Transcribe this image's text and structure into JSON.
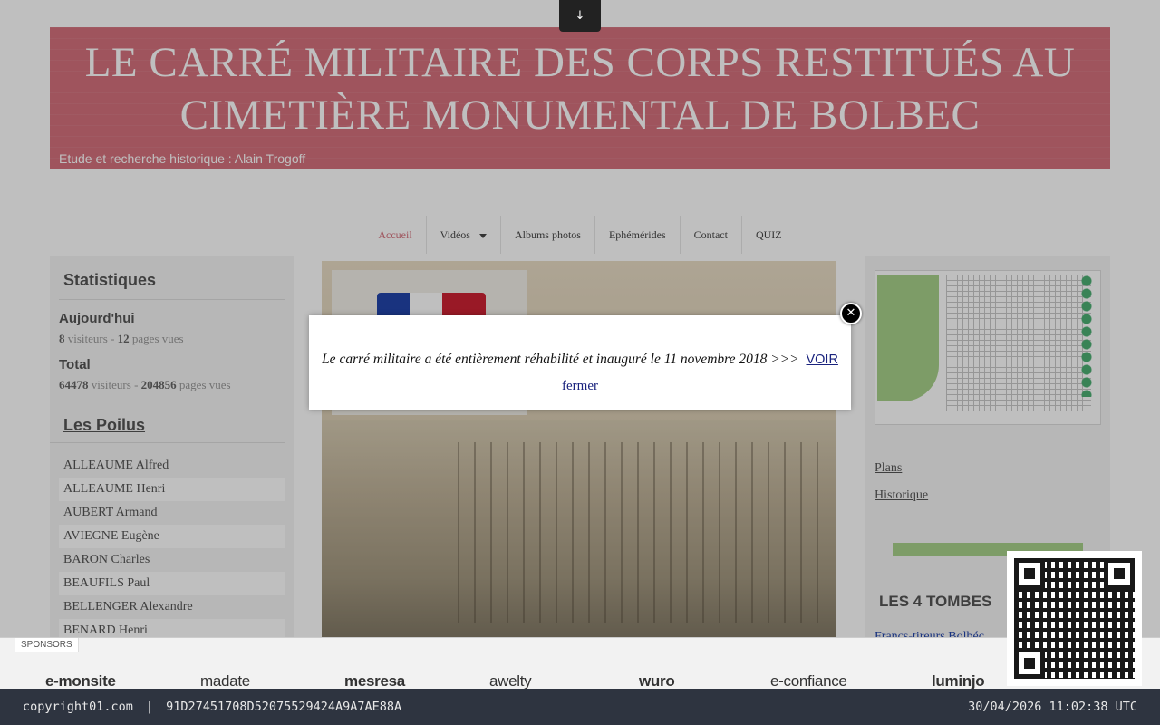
{
  "download_tab": {
    "icon": "download-arrow-icon",
    "glyph": "↓"
  },
  "header": {
    "title": "LE CARRÉ MILITAIRE DES CORPS RESTITUÉS AU CIMETIÈRE MONUMENTAL DE BOLBEC",
    "subtitle": "Etude et recherche historique : Alain Trogoff"
  },
  "menu": {
    "items": [
      {
        "label": "Accueil",
        "active": true
      },
      {
        "label": "Vidéos",
        "has_dropdown": true
      },
      {
        "label": "Albums photos"
      },
      {
        "label": "Ephémérides"
      },
      {
        "label": "Contact"
      },
      {
        "label": "QUIZ"
      }
    ]
  },
  "stats": {
    "title": "Statistiques",
    "today_label": "Aujourd'hui",
    "today_visitors": "8",
    "today_visitors_suffix": "visiteurs",
    "today_pages": "12",
    "today_pages_suffix": "pages vues",
    "total_label": "Total",
    "total_visitors": "64478",
    "total_visitors_suffix": "visiteurs",
    "total_pages": "204856",
    "total_pages_suffix": "pages vues",
    "separator": "-"
  },
  "poilus": {
    "title": "Les Poilus",
    "items": [
      "ALLEAUME Alfred",
      "ALLEAUME Henri",
      "AUBERT Armand",
      "AVIEGNE Eugène",
      "BARON Charles",
      "BEAUFILS Paul",
      "BELLENGER Alexandre",
      "BENARD Henri"
    ]
  },
  "right": {
    "links": [
      "Plans",
      "Historique"
    ],
    "section_title": "LES 4 TOMBES",
    "francs_link": "Francs-tireurs Bolbéc"
  },
  "modal": {
    "message": "Le carré militaire a été entièrement réhabilité et inauguré le 11 novembre 2018 >>>",
    "link_label": "VOIR",
    "close_label": "fermer",
    "close_icon": "close-icon"
  },
  "sponsors": {
    "label": "SPONSORS",
    "items": [
      "e-monsite",
      "madate",
      "mesresa",
      "awelty",
      "wuro",
      "e-confiance",
      "luminjo"
    ]
  },
  "footer": {
    "left": "copyright01.com",
    "separator": "|",
    "hash": "91D27451708D52075529424A9A7AE88A",
    "timestamp": "30/04/2026 11:02:38 UTC"
  },
  "colors": {
    "header_bg": "#d4707c",
    "menu_active": "#d4707c",
    "link_blue": "#1a237e",
    "footer_bg": "#2e3440"
  }
}
